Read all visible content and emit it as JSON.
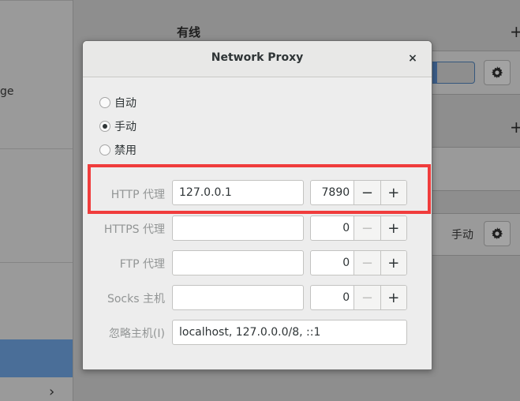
{
  "background": {
    "sidebar_partial_text": "ge",
    "section_heading": "有线",
    "manual_label": "手动"
  },
  "dialog": {
    "title": "Network Proxy",
    "close_glyph": "×",
    "method_options": [
      {
        "label": "自动",
        "checked": false
      },
      {
        "label": "手动",
        "checked": true
      },
      {
        "label": "禁用",
        "checked": false
      }
    ],
    "http": {
      "label": "HTTP 代理",
      "host": "127.0.0.1",
      "port": "7890"
    },
    "https": {
      "label": "HTTPS 代理",
      "host": "",
      "port": "0"
    },
    "ftp": {
      "label": "FTP 代理",
      "host": "",
      "port": "0"
    },
    "socks": {
      "label": "Socks 主机",
      "host": "",
      "port": "0"
    },
    "ignore": {
      "label": "忽略主机(I)",
      "value": "localhost, 127.0.0.0/8, ::1"
    },
    "spin_minus": "−",
    "spin_plus": "+"
  },
  "colors": {
    "highlight": "#f03c3c",
    "selection": "#4a6e98"
  },
  "icons": {
    "close": "close-icon",
    "gear": "gear-icon",
    "plus": "plus-icon",
    "chevron": "chevron-right-icon"
  }
}
